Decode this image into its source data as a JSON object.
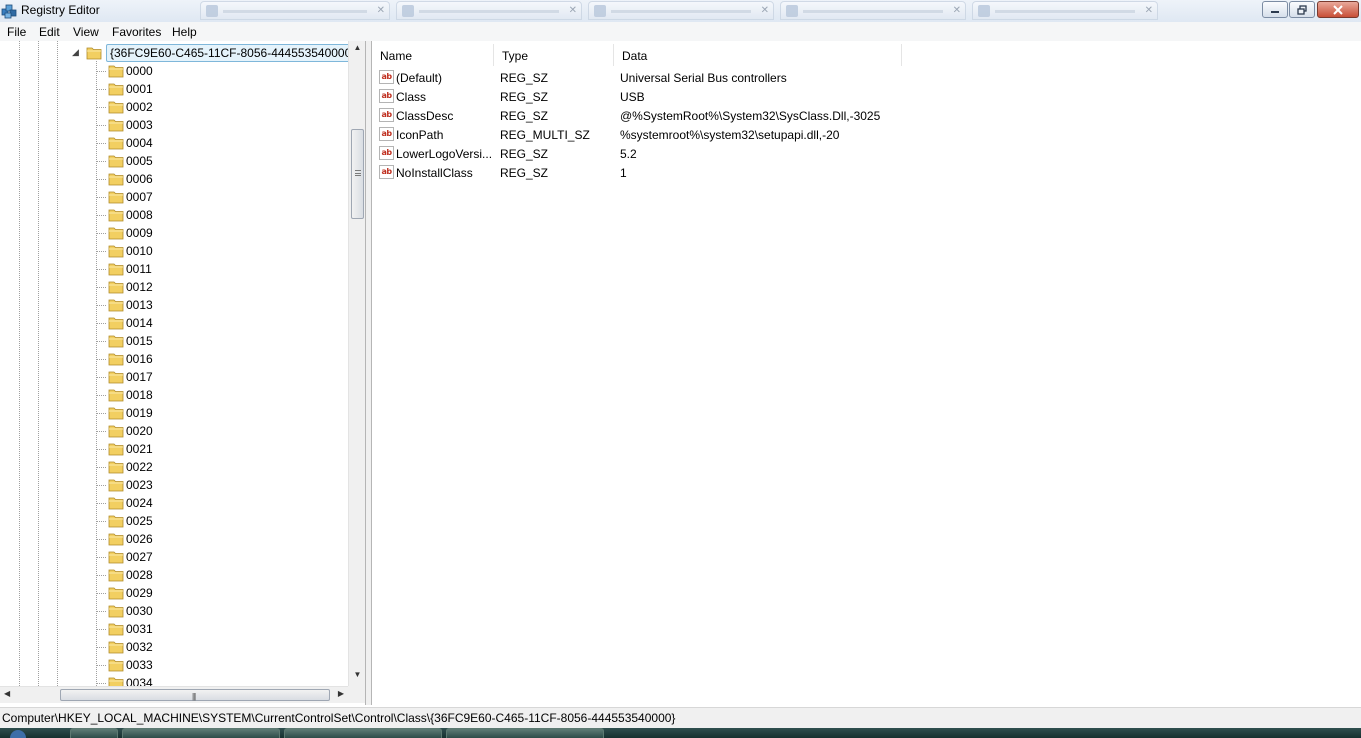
{
  "window": {
    "title": "Registry Editor",
    "icon": "registry-editor-icon"
  },
  "menu": [
    "File",
    "Edit",
    "View",
    "Favorites",
    "Help"
  ],
  "tree": {
    "selected_key": "{36FC9E60-C465-11CF-8056-444553540000}",
    "children": [
      "0000",
      "0001",
      "0002",
      "0003",
      "0004",
      "0005",
      "0006",
      "0007",
      "0008",
      "0009",
      "0010",
      "0011",
      "0012",
      "0013",
      "0014",
      "0015",
      "0016",
      "0017",
      "0018",
      "0019",
      "0020",
      "0021",
      "0022",
      "0023",
      "0024",
      "0025",
      "0026",
      "0027",
      "0028",
      "0029",
      "0030",
      "0031",
      "0032",
      "0033",
      "0034"
    ]
  },
  "values": {
    "columns": [
      "Name",
      "Type",
      "Data"
    ],
    "rows": [
      {
        "name": "(Default)",
        "type": "REG_SZ",
        "data": "Universal Serial Bus controllers"
      },
      {
        "name": "Class",
        "type": "REG_SZ",
        "data": "USB"
      },
      {
        "name": "ClassDesc",
        "type": "REG_SZ",
        "data": "@%SystemRoot%\\System32\\SysClass.Dll,-3025"
      },
      {
        "name": "IconPath",
        "type": "REG_MULTI_SZ",
        "data": "%systemroot%\\system32\\setupapi.dll,-20"
      },
      {
        "name": "LowerLogoVersi...",
        "type": "REG_SZ",
        "data": "5.2"
      },
      {
        "name": "NoInstallClass",
        "type": "REG_SZ",
        "data": "1"
      }
    ],
    "row_icon_text": "ab"
  },
  "statusbar": {
    "path": "Computer\\HKEY_LOCAL_MACHINE\\SYSTEM\\CurrentControlSet\\Control\\Class\\{36FC9E60-C465-11CF-8056-444553540000}"
  },
  "colors": {
    "selection_bg": "#e5f3fb",
    "selection_border": "#7fb7da",
    "folder_yellow": "#f2cf61",
    "string_icon_red": "#c03020"
  }
}
